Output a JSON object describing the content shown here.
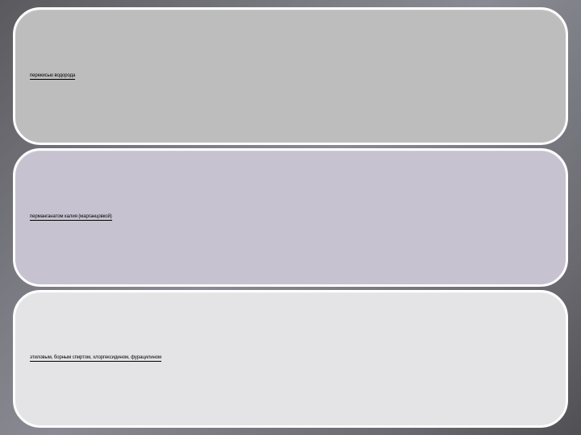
{
  "cards": [
    {
      "label": "перекисью водорода"
    },
    {
      "label": "перманганатом калия (марганцовкой)"
    },
    {
      "label": "этиловым, борным спиртом, хлоргексидином, фурацилином"
    }
  ]
}
